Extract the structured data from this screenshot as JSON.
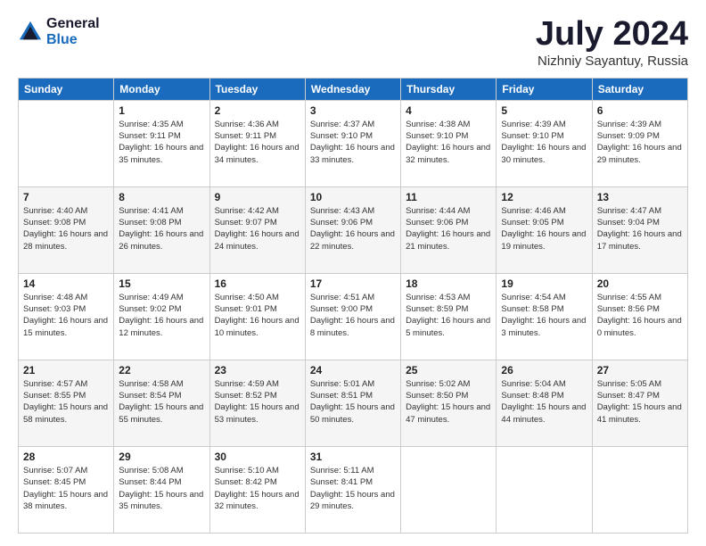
{
  "logo": {
    "general": "General",
    "blue": "Blue"
  },
  "title": "July 2024",
  "location": "Nizhniy Sayantuy, Russia",
  "days_of_week": [
    "Sunday",
    "Monday",
    "Tuesday",
    "Wednesday",
    "Thursday",
    "Friday",
    "Saturday"
  ],
  "weeks": [
    [
      {
        "day": "",
        "sunrise": "",
        "sunset": "",
        "daylight": ""
      },
      {
        "day": "1",
        "sunrise": "Sunrise: 4:35 AM",
        "sunset": "Sunset: 9:11 PM",
        "daylight": "Daylight: 16 hours and 35 minutes."
      },
      {
        "day": "2",
        "sunrise": "Sunrise: 4:36 AM",
        "sunset": "Sunset: 9:11 PM",
        "daylight": "Daylight: 16 hours and 34 minutes."
      },
      {
        "day": "3",
        "sunrise": "Sunrise: 4:37 AM",
        "sunset": "Sunset: 9:10 PM",
        "daylight": "Daylight: 16 hours and 33 minutes."
      },
      {
        "day": "4",
        "sunrise": "Sunrise: 4:38 AM",
        "sunset": "Sunset: 9:10 PM",
        "daylight": "Daylight: 16 hours and 32 minutes."
      },
      {
        "day": "5",
        "sunrise": "Sunrise: 4:39 AM",
        "sunset": "Sunset: 9:10 PM",
        "daylight": "Daylight: 16 hours and 30 minutes."
      },
      {
        "day": "6",
        "sunrise": "Sunrise: 4:39 AM",
        "sunset": "Sunset: 9:09 PM",
        "daylight": "Daylight: 16 hours and 29 minutes."
      }
    ],
    [
      {
        "day": "7",
        "sunrise": "Sunrise: 4:40 AM",
        "sunset": "Sunset: 9:08 PM",
        "daylight": "Daylight: 16 hours and 28 minutes."
      },
      {
        "day": "8",
        "sunrise": "Sunrise: 4:41 AM",
        "sunset": "Sunset: 9:08 PM",
        "daylight": "Daylight: 16 hours and 26 minutes."
      },
      {
        "day": "9",
        "sunrise": "Sunrise: 4:42 AM",
        "sunset": "Sunset: 9:07 PM",
        "daylight": "Daylight: 16 hours and 24 minutes."
      },
      {
        "day": "10",
        "sunrise": "Sunrise: 4:43 AM",
        "sunset": "Sunset: 9:06 PM",
        "daylight": "Daylight: 16 hours and 22 minutes."
      },
      {
        "day": "11",
        "sunrise": "Sunrise: 4:44 AM",
        "sunset": "Sunset: 9:06 PM",
        "daylight": "Daylight: 16 hours and 21 minutes."
      },
      {
        "day": "12",
        "sunrise": "Sunrise: 4:46 AM",
        "sunset": "Sunset: 9:05 PM",
        "daylight": "Daylight: 16 hours and 19 minutes."
      },
      {
        "day": "13",
        "sunrise": "Sunrise: 4:47 AM",
        "sunset": "Sunset: 9:04 PM",
        "daylight": "Daylight: 16 hours and 17 minutes."
      }
    ],
    [
      {
        "day": "14",
        "sunrise": "Sunrise: 4:48 AM",
        "sunset": "Sunset: 9:03 PM",
        "daylight": "Daylight: 16 hours and 15 minutes."
      },
      {
        "day": "15",
        "sunrise": "Sunrise: 4:49 AM",
        "sunset": "Sunset: 9:02 PM",
        "daylight": "Daylight: 16 hours and 12 minutes."
      },
      {
        "day": "16",
        "sunrise": "Sunrise: 4:50 AM",
        "sunset": "Sunset: 9:01 PM",
        "daylight": "Daylight: 16 hours and 10 minutes."
      },
      {
        "day": "17",
        "sunrise": "Sunrise: 4:51 AM",
        "sunset": "Sunset: 9:00 PM",
        "daylight": "Daylight: 16 hours and 8 minutes."
      },
      {
        "day": "18",
        "sunrise": "Sunrise: 4:53 AM",
        "sunset": "Sunset: 8:59 PM",
        "daylight": "Daylight: 16 hours and 5 minutes."
      },
      {
        "day": "19",
        "sunrise": "Sunrise: 4:54 AM",
        "sunset": "Sunset: 8:58 PM",
        "daylight": "Daylight: 16 hours and 3 minutes."
      },
      {
        "day": "20",
        "sunrise": "Sunrise: 4:55 AM",
        "sunset": "Sunset: 8:56 PM",
        "daylight": "Daylight: 16 hours and 0 minutes."
      }
    ],
    [
      {
        "day": "21",
        "sunrise": "Sunrise: 4:57 AM",
        "sunset": "Sunset: 8:55 PM",
        "daylight": "Daylight: 15 hours and 58 minutes."
      },
      {
        "day": "22",
        "sunrise": "Sunrise: 4:58 AM",
        "sunset": "Sunset: 8:54 PM",
        "daylight": "Daylight: 15 hours and 55 minutes."
      },
      {
        "day": "23",
        "sunrise": "Sunrise: 4:59 AM",
        "sunset": "Sunset: 8:52 PM",
        "daylight": "Daylight: 15 hours and 53 minutes."
      },
      {
        "day": "24",
        "sunrise": "Sunrise: 5:01 AM",
        "sunset": "Sunset: 8:51 PM",
        "daylight": "Daylight: 15 hours and 50 minutes."
      },
      {
        "day": "25",
        "sunrise": "Sunrise: 5:02 AM",
        "sunset": "Sunset: 8:50 PM",
        "daylight": "Daylight: 15 hours and 47 minutes."
      },
      {
        "day": "26",
        "sunrise": "Sunrise: 5:04 AM",
        "sunset": "Sunset: 8:48 PM",
        "daylight": "Daylight: 15 hours and 44 minutes."
      },
      {
        "day": "27",
        "sunrise": "Sunrise: 5:05 AM",
        "sunset": "Sunset: 8:47 PM",
        "daylight": "Daylight: 15 hours and 41 minutes."
      }
    ],
    [
      {
        "day": "28",
        "sunrise": "Sunrise: 5:07 AM",
        "sunset": "Sunset: 8:45 PM",
        "daylight": "Daylight: 15 hours and 38 minutes."
      },
      {
        "day": "29",
        "sunrise": "Sunrise: 5:08 AM",
        "sunset": "Sunset: 8:44 PM",
        "daylight": "Daylight: 15 hours and 35 minutes."
      },
      {
        "day": "30",
        "sunrise": "Sunrise: 5:10 AM",
        "sunset": "Sunset: 8:42 PM",
        "daylight": "Daylight: 15 hours and 32 minutes."
      },
      {
        "day": "31",
        "sunrise": "Sunrise: 5:11 AM",
        "sunset": "Sunset: 8:41 PM",
        "daylight": "Daylight: 15 hours and 29 minutes."
      },
      {
        "day": "",
        "sunrise": "",
        "sunset": "",
        "daylight": ""
      },
      {
        "day": "",
        "sunrise": "",
        "sunset": "",
        "daylight": ""
      },
      {
        "day": "",
        "sunrise": "",
        "sunset": "",
        "daylight": ""
      }
    ]
  ]
}
